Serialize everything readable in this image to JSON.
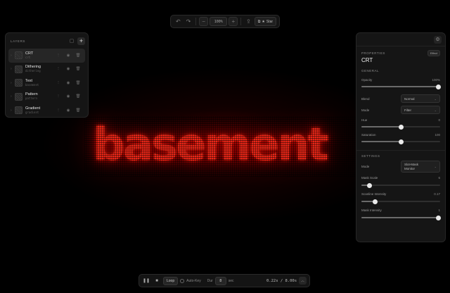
{
  "canvas": {
    "text": "basement",
    "glow_color": "#ff1a0a"
  },
  "toolbar": {
    "undo_icon": "↶",
    "redo_icon": "↷",
    "zoom_out_icon": "−",
    "zoom": "100%",
    "zoom_in_icon": "+",
    "export_icon": "⇪",
    "share_icon": "⧉",
    "star_icon": "★",
    "share_label": "Star"
  },
  "layers": {
    "title": "LAYERS",
    "items": [
      {
        "name": "CRT",
        "type": "crt",
        "active": true
      },
      {
        "name": "Dithering",
        "type": "dithering",
        "active": false
      },
      {
        "name": "Text",
        "type": "basement",
        "active": false
      },
      {
        "name": "Pattern",
        "type": "pattern",
        "active": false
      },
      {
        "name": "Gradient",
        "type": "gradient",
        "active": false
      }
    ]
  },
  "properties": {
    "label": "PROPERTIES",
    "badge": "Effect",
    "effect_name": "CRT",
    "general": {
      "title": "GENERAL",
      "opacity": {
        "label": "Opacity",
        "value": "100%",
        "fraction": 1.0
      },
      "blend": {
        "label": "Blend",
        "value": "Normal"
      },
      "mode": {
        "label": "Mode",
        "value": "Filter"
      },
      "hue": {
        "label": "Hue",
        "value": "0",
        "fraction": 0.5
      },
      "saturation": {
        "label": "Saturation",
        "value": "100",
        "fraction": 0.5
      }
    },
    "settings": {
      "title": "SETTINGS",
      "mode": {
        "label": "Mode",
        "value_line1": "Slot-Mask",
        "value_line2": "Monitor"
      },
      "mask_scale": {
        "label": "Mask Scale",
        "value": "6",
        "fraction": 0.1
      },
      "scanline_intensity": {
        "label": "Scanline Intensity",
        "value": "0.17",
        "fraction": 0.17
      },
      "mask_intensity": {
        "label": "Mask Intensity",
        "value": "1",
        "fraction": 1.0
      }
    }
  },
  "bottom": {
    "pause_icon": "❚❚",
    "stop_icon": "■",
    "loop_label": "Loop",
    "autokey_label": "Auto-Key",
    "dur_label": "Dur",
    "dur_value": "8",
    "sec_label": "sec",
    "time": "0.22s / 8.00s",
    "up_icon": "︿"
  }
}
